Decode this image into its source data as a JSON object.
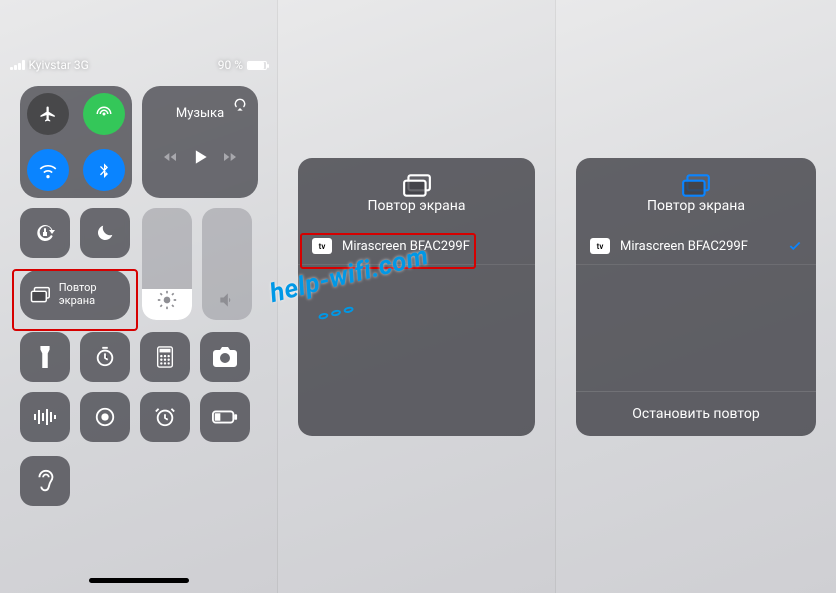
{
  "status": {
    "carrier": "Kyivstar 3G",
    "battery_pct": "90 %"
  },
  "sliders": {
    "brightness": 28,
    "volume": 0
  },
  "media": {
    "title": "Музыка"
  },
  "mirror_tile": {
    "label": "Повтор экрана"
  },
  "sheet_b": {
    "title": "Повтор экрана",
    "device": "Mirascreen BFAC299F"
  },
  "sheet_c": {
    "title": "Повтор экрана",
    "device": "Mirascreen BFAC299F",
    "stop": "Остановить повтор"
  },
  "watermark": "help-wifi.com",
  "icons": {
    "airplane": "airplane-icon",
    "cellular": "cellular-icon",
    "wifi": "wifi-icon",
    "bluetooth": "bluetooth-icon",
    "airplay": "airplay-icon",
    "back": "back-icon",
    "play": "play-icon",
    "fwd": "forward-icon",
    "lock": "rotation-lock-icon",
    "moon": "do-not-disturb-icon",
    "brightness": "brightness-icon",
    "volume": "volume-icon",
    "screen_mirror": "screen-mirroring-icon",
    "flashlight": "flashlight-icon",
    "timer": "timer-icon",
    "calculator": "calculator-icon",
    "camera": "camera-icon",
    "memo": "voice-memo-icon",
    "record": "screen-record-icon",
    "alarm": "alarm-icon",
    "lowpower": "low-power-icon",
    "hearing": "hearing-icon"
  },
  "colors": {
    "highlight": "#d60000",
    "accent_blue": "#0a84ff",
    "accent_green": "#34c759"
  }
}
